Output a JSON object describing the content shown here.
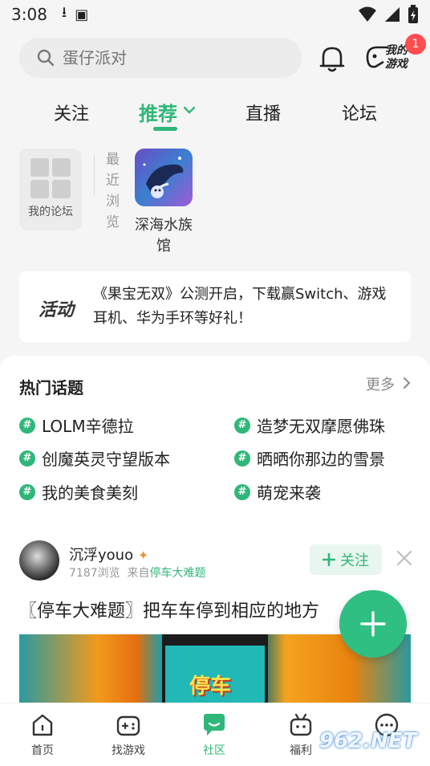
{
  "status_bar": {
    "time": "3:08"
  },
  "search": {
    "placeholder": "蛋仔派对"
  },
  "header": {
    "my_games_label": "我的游戏",
    "notification_count": "1"
  },
  "tabs": [
    {
      "label": "关注",
      "active": false
    },
    {
      "label": "推荐",
      "active": true
    },
    {
      "label": "直播",
      "active": false
    },
    {
      "label": "论坛",
      "active": false
    }
  ],
  "shortcuts": {
    "my_forum_label": "我的论坛",
    "recent_label": "最近浏览",
    "recent_game_name": "深海水族馆"
  },
  "banner": {
    "tag": "活动",
    "text": "《果宝无双》公测开启，下载赢Switch、游戏耳机、华为手环等好礼！"
  },
  "hot_topics": {
    "title": "热门话题",
    "more_label": "更多",
    "items": [
      "LOLM辛德拉",
      "造梦无双摩愿佛珠",
      "创魔英灵守望版本",
      "晒晒你那边的雪景",
      "我的美食美刻",
      "萌宠来袭"
    ]
  },
  "post": {
    "username": "沉浮youo",
    "views": "7187浏览",
    "from_prefix": "来自",
    "from_forum": "停车大难题",
    "follow_label": "关注",
    "title": "〖停车大难题〗把车车停到相应的地方",
    "image_caption": "停车"
  },
  "bottom_nav": [
    {
      "label": "首页",
      "icon": "home-icon",
      "active": false
    },
    {
      "label": "找游戏",
      "icon": "gamepad-icon",
      "active": false
    },
    {
      "label": "社区",
      "icon": "chat-icon",
      "active": true
    },
    {
      "label": "福利",
      "icon": "gift-icon",
      "active": false
    },
    {
      "label": "",
      "icon": "more-icon",
      "active": false
    }
  ],
  "watermark": "962.NET",
  "colors": {
    "accent": "#2fb779",
    "badge": "#ff4d4f"
  }
}
